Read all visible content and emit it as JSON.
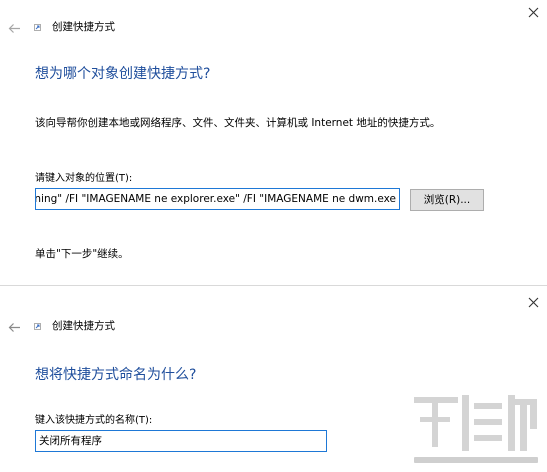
{
  "top_dialog": {
    "title": "创建快捷方式",
    "heading": "想为哪个对象创建快捷方式?",
    "description": "该向导帮你创建本地或网络程序、文件、文件夹、计算机或 Internet 地址的快捷方式。",
    "location_label": "请键入对象的位置(T):",
    "location_value": "-im igfxEM.exe /FI \"STATUS eq running\" /FI \"IMAGENAME ne explorer.exe\" /FI \"IMAGENAME ne dwm.exe",
    "browse_label": "浏览(R)...",
    "next_hint": "单击\"下一步\"继续。"
  },
  "bottom_dialog": {
    "title": "创建快捷方式",
    "heading": "想将快捷方式命名为什么?",
    "name_label": "键入该快捷方式的名称(T):",
    "name_value": "关闭所有程序"
  },
  "icons": [
    "close-icon",
    "back-arrow-icon",
    "shortcut-icon"
  ],
  "colors": {
    "heading": "#1f4e9c",
    "input_border": "#1e78d6",
    "button_bg": "#e1e1e1"
  }
}
